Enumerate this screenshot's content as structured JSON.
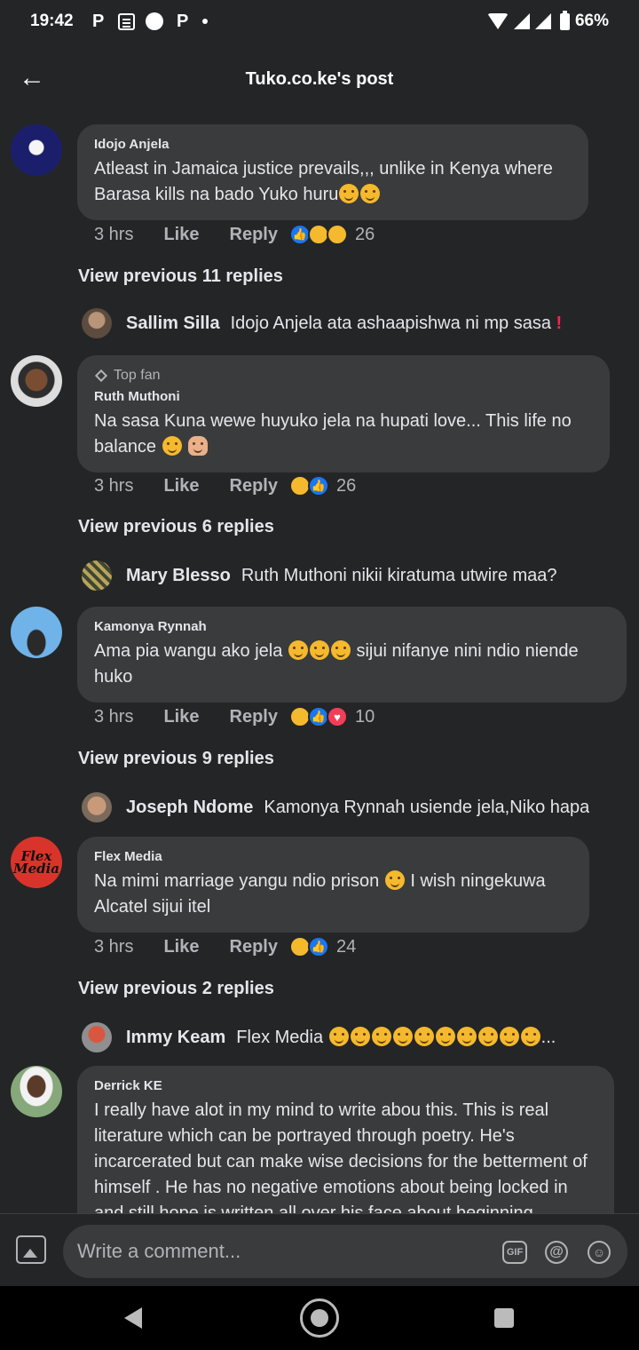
{
  "status_bar": {
    "time": "19:42",
    "apps": [
      "P",
      "P"
    ],
    "battery": "66%",
    "icons": [
      "pinterest-icon",
      "news-icon",
      "whatsapp-icon",
      "pinterest-icon",
      "dot-icon",
      "wifi-icon",
      "signal-icon",
      "battery-icon"
    ]
  },
  "header": {
    "title": "Tuko.co.ke's post",
    "back_icon": "arrow-left-icon"
  },
  "comments": [
    {
      "author": "Idojo Anjela",
      "badge": "",
      "text": "Atleast in Jamaica justice prevails,,, unlike in Kenya where Barasa kills na bado Yuko huru",
      "time": "3 hrs",
      "like_label": "Like",
      "reply_label": "Reply",
      "reaction_count": "26",
      "view_previous": "View previous 11 replies",
      "reply": {
        "author": "Sallim Silla",
        "text": "Idojo Anjela ata ashaapishwa ni mp sasa",
        "mark": "!"
      }
    },
    {
      "author": "Ruth Muthoni",
      "badge": "Top fan",
      "text": "Na sasa Kuna wewe huyuko jela na hupati love... This life no balance",
      "time": "3 hrs",
      "like_label": "Like",
      "reply_label": "Reply",
      "reaction_count": "26",
      "view_previous": "View previous 6 replies",
      "reply": {
        "author": "Mary Blesso",
        "text": "Ruth Muthoni  nikii kiratuma utwire maa?",
        "mark": ""
      }
    },
    {
      "author": "Kamonya Rynnah",
      "badge": "",
      "text": "Ama pia wangu ako jela",
      "text2": "sijui nifanye nini ndio niende huko",
      "time": "3 hrs",
      "like_label": "Like",
      "reply_label": "Reply",
      "reaction_count": "10",
      "view_previous": "View previous 9 replies",
      "reply": {
        "author": "Joseph Ndome",
        "text": "Kamonya Rynnah usiende jela,Niko hapa",
        "mark": ""
      }
    },
    {
      "author": "Flex Media",
      "badge": "",
      "text": "Na mimi marriage yangu ndio prison",
      "text2": "I wish ningekuwa Alcatel sijui itel",
      "time": "3 hrs",
      "like_label": "Like",
      "reply_label": "Reply",
      "reaction_count": "24",
      "view_previous": "View previous 2 replies",
      "reply": {
        "author": "Immy Keam",
        "text": "Flex Media",
        "mark": "..."
      }
    },
    {
      "author": "Derrick KE",
      "badge": "",
      "text": "I really have alot in my mind to write abou this. This is real literature which can be portrayed through poetry. He's incarcerated but can make wise decisions for the betterment of himself . He has no negative emotions about being locked in and still hope is written all over his face about beginning"
    }
  ],
  "composer": {
    "placeholder": "Write a comment...",
    "gif_label": "GIF",
    "at_label": "@",
    "smile_label": "☺"
  },
  "colors": {
    "background": "#242526",
    "bubble": "#3a3b3c",
    "text": "#e4e6eb",
    "secondary": "#b0b3b8",
    "like_blue": "#1877f2",
    "love_red": "#f33e58"
  }
}
